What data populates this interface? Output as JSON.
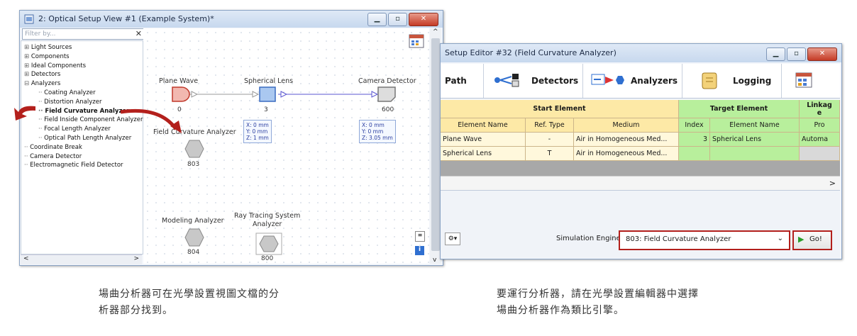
{
  "left_window": {
    "title": "2: Optical Setup View #1 (Example System)*",
    "filter_placeholder": "Filter by...",
    "tree": [
      {
        "label": "Light Sources",
        "prefix": "⊞",
        "level": 0,
        "bold": false
      },
      {
        "label": "Components",
        "prefix": "⊞",
        "level": 0,
        "bold": false
      },
      {
        "label": "Ideal Components",
        "prefix": "⊞",
        "level": 0,
        "bold": false
      },
      {
        "label": "Detectors",
        "prefix": "⊞",
        "level": 0,
        "bold": false
      },
      {
        "label": "Analyzers",
        "prefix": "⊟",
        "level": 0,
        "bold": false
      },
      {
        "label": "Coating Analyzer",
        "prefix": "",
        "level": 1,
        "bold": false
      },
      {
        "label": "Distortion Analyzer",
        "prefix": "",
        "level": 1,
        "bold": false
      },
      {
        "label": "Field Curvature Analyzer",
        "prefix": "",
        "level": 1,
        "bold": true
      },
      {
        "label": "Field Inside Component Analyzer",
        "prefix": "",
        "level": 1,
        "bold": false
      },
      {
        "label": "Focal Length Analyzer",
        "prefix": "",
        "level": 1,
        "bold": false
      },
      {
        "label": "Optical Path Length Analyzer",
        "prefix": "",
        "level": 1,
        "bold": false
      },
      {
        "label": "Coordinate Break",
        "prefix": "",
        "level": 0,
        "bold": false
      },
      {
        "label": "Camera Detector",
        "prefix": "",
        "level": 0,
        "bold": false
      },
      {
        "label": "Electromagnetic Field Detector",
        "prefix": "",
        "level": 0,
        "bold": false
      }
    ],
    "nodes": {
      "plane_wave": {
        "label": "Plane Wave",
        "index": "0"
      },
      "spherical_lens": {
        "label": "Spherical Lens",
        "index": "3",
        "coords": "X: 0 mm\nY: 0 mm\nZ: 1 mm"
      },
      "camera_detector": {
        "label": "Camera Detector",
        "index": "600",
        "coords": "X: 0 mm\nY: 0 mm\nZ: 3.05 mm"
      },
      "field_curvature": {
        "label": "Field Curvature Analyzer",
        "index": "803"
      },
      "modeling": {
        "label": "Modeling Analyzer",
        "index": "804"
      },
      "ray_tracing": {
        "label": "Ray Tracing System\nAnalyzer",
        "index": "800"
      }
    }
  },
  "right_window": {
    "title": "Setup Editor #32 (Field Curvature Analyzer)",
    "tabs": [
      "Path",
      "Detectors",
      "Analyzers",
      "Logging"
    ],
    "table": {
      "group_start": "Start Element",
      "group_target": "Target Element",
      "group_linkage": "Linkag\ne",
      "headers": [
        "Element Name",
        "Ref. Type",
        "Medium",
        "Index",
        "Element Name",
        "Pro"
      ],
      "rows": [
        [
          "Plane Wave",
          "-",
          "Air in Homogeneous Med...",
          "3",
          "Spherical Lens",
          "Automa"
        ],
        [
          "Spherical Lens",
          "T",
          "Air in Homogeneous Med...",
          "",
          "",
          ""
        ]
      ]
    },
    "engine_label": "Simulation Engine",
    "engine_value": "803: Field Curvature Analyzer",
    "go_label": "Go!"
  },
  "captions": {
    "left": "場曲分析器可在光學設置視圖文檔的分\n析器部分找到。",
    "right": "要運行分析器，請在光學設置編輯器中選擇\n場曲分析器作為類比引擎。"
  },
  "colors": {
    "accent_red": "#b3201c",
    "start_yellow": "#fde9a6",
    "target_green": "#b8ef9c"
  }
}
